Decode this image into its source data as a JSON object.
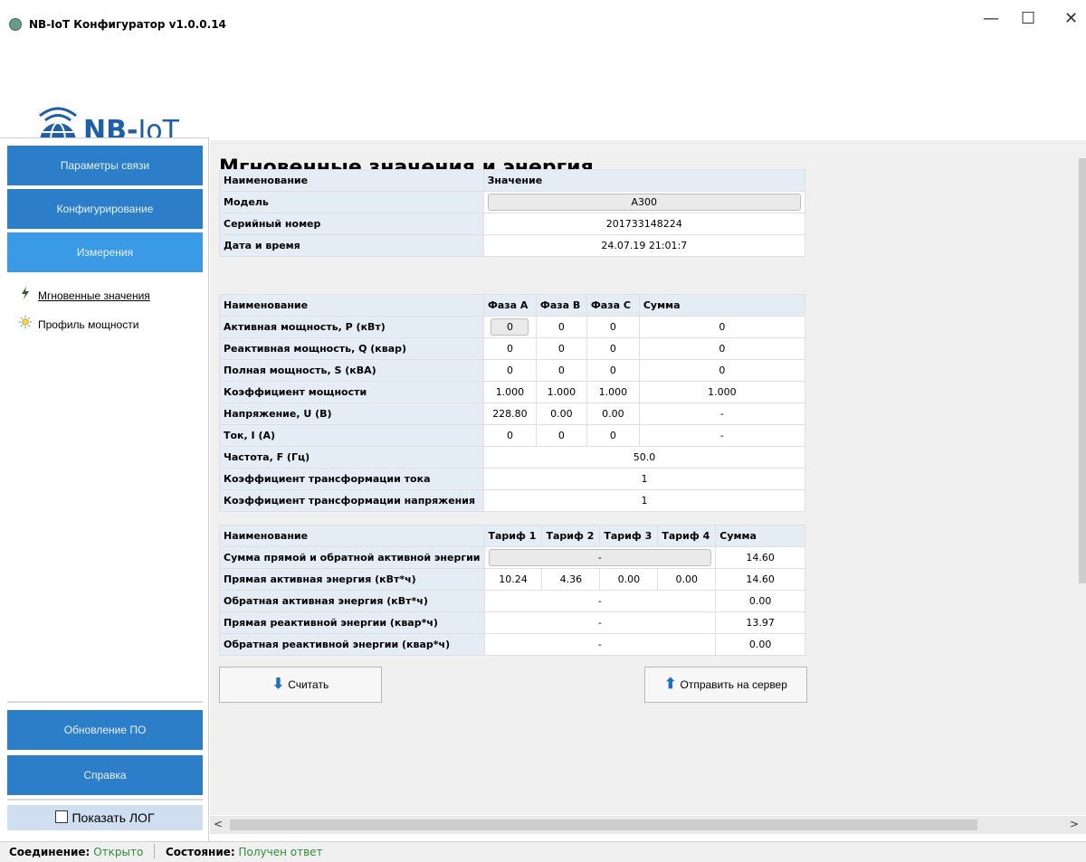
{
  "window": {
    "title": "NB-IoT Конфигуратор v1.0.0.14",
    "minimize_glyph": "—",
    "maximize_glyph": "☐",
    "close_glyph": "✕"
  },
  "logo": {
    "text_bold": "NB-",
    "text_light": "IoT"
  },
  "sidebar": {
    "nav": [
      {
        "label": "Параметры связи"
      },
      {
        "label": "Конфигурирование"
      },
      {
        "label": "Измерения",
        "active": true
      }
    ],
    "sub_items": [
      {
        "label": "Мгновенные значения",
        "icon": "lightning-icon",
        "current": true
      },
      {
        "label": "Профиль мощности",
        "icon": "sun-icon",
        "current": false
      }
    ],
    "bottom_nav": [
      {
        "label": "Обновление ПО"
      },
      {
        "label": "Справка"
      }
    ],
    "show_log_label": "Показать ЛОГ",
    "show_log_checked": false
  },
  "main": {
    "title": "Мгновенные значения и энергия",
    "info_table": {
      "headers": [
        "Наименование",
        "Значение"
      ],
      "rows": [
        {
          "name": "Модель",
          "value": "A300",
          "boxed": true
        },
        {
          "name": "Серийный номер",
          "value": "201733148224"
        },
        {
          "name": "Дата и время",
          "value": "24.07.19 21:01:7"
        }
      ]
    },
    "power_table": {
      "headers": [
        "Наименование",
        "Фаза А",
        "Фаза В",
        "Фаза С",
        "Сумма"
      ],
      "rows": [
        {
          "name": "Активная мощность, P (кВт)",
          "a": "0",
          "b": "0",
          "c": "0",
          "sum": "0",
          "a_boxed": true
        },
        {
          "name": "Реактивная мощность, Q (квар)",
          "a": "0",
          "b": "0",
          "c": "0",
          "sum": "0"
        },
        {
          "name": "Полная мощность, S (кВА)",
          "a": "0",
          "b": "0",
          "c": "0",
          "sum": "0"
        },
        {
          "name": "Коэффициент мощности",
          "a": "1.000",
          "b": "1.000",
          "c": "1.000",
          "sum": "1.000"
        },
        {
          "name": "Напряжение, U (В)",
          "a": "228.80",
          "b": "0.00",
          "c": "0.00",
          "sum": "-"
        },
        {
          "name": "Ток, I (А)",
          "a": "0",
          "b": "0",
          "c": "0",
          "sum": "-"
        }
      ],
      "span_rows": [
        {
          "name": "Частота, F (Гц)",
          "value": "50.0"
        },
        {
          "name": "Коэффициент трансформации тока",
          "value": "1"
        },
        {
          "name": "Коэффициент трансформации напряжения",
          "value": "1"
        }
      ]
    },
    "energy_table": {
      "headers": [
        "Наименование",
        "Тариф 1",
        "Тариф 2",
        "Тариф 3",
        "Тариф 4",
        "Сумма"
      ],
      "rows": [
        {
          "name": "Сумма прямой и обратной активной энергии",
          "merged": "-",
          "merged_boxed": true,
          "sum": "14.60"
        },
        {
          "name": "Прямая активная энергия (кВт*ч)",
          "t1": "10.24",
          "t2": "4.36",
          "t3": "0.00",
          "t4": "0.00",
          "sum": "14.60"
        },
        {
          "name": "Обратная активная энергия (кВт*ч)",
          "merged": "-",
          "sum": "0.00"
        },
        {
          "name": "Прямая реактивной энергии (квар*ч)",
          "merged": "-",
          "sum": "13.97"
        },
        {
          "name": "Обратная реактивной энергии (квар*ч)",
          "merged": "-",
          "sum": "0.00"
        }
      ]
    },
    "buttons": {
      "read_label": "Считать",
      "send_label": "Отправить на сервер"
    }
  },
  "status": {
    "connection_key": "Соединение:",
    "connection_value": "Открыто",
    "state_key": "Состояние:",
    "state_value": "Получен ответ"
  },
  "colors": {
    "nav_blue": "#2d7ec8",
    "nav_active": "#3b9ae6",
    "header_cell": "#e4ecf6",
    "status_ok": "#2e8b3a",
    "logo_blue": "#1e5fa8"
  }
}
